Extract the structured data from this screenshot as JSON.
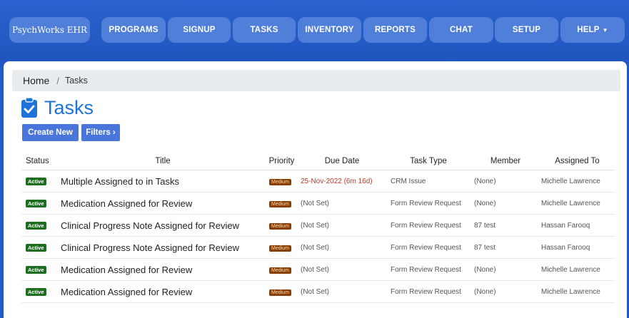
{
  "brand": {
    "label": "PsychWorks EHR"
  },
  "nav": [
    {
      "label": "PROGRAMS"
    },
    {
      "label": "SIGNUP"
    },
    {
      "label": "TASKS"
    },
    {
      "label": "INVENTORY"
    },
    {
      "label": "REPORTS"
    },
    {
      "label": "CHAT"
    },
    {
      "label": "SETUP"
    },
    {
      "label": "HELP"
    }
  ],
  "breadcrumb": {
    "home": "Home",
    "separator": "/",
    "current": "Tasks"
  },
  "page": {
    "title": "Tasks",
    "icon": "clipboard-check-icon"
  },
  "actions": {
    "create_new": "Create New",
    "filters": "Filters ›"
  },
  "table": {
    "columns": [
      "Status",
      "Title",
      "Priority",
      "Due Date",
      "Task Type",
      "Member",
      "Assigned To"
    ],
    "rows": [
      {
        "status": "Active",
        "title": "Multiple Assigned to in Tasks",
        "priority": "Medium",
        "due": "25-Nov-2022 (6m 16d)",
        "type": "CRM Issue",
        "member": "(None)",
        "assigned": "Michelle Lawrence"
      },
      {
        "status": "Active",
        "title": "Medication Assigned for Review",
        "priority": "Medium",
        "due": "(Not Set)",
        "type": "Form Review Request",
        "member": "(None)",
        "assigned": "Michelle Lawrence"
      },
      {
        "status": "Active",
        "title": "Clinical Progress Note Assigned for Review",
        "priority": "Medium",
        "due": "(Not Set)",
        "type": "Form Review Request",
        "member": "87 test",
        "assigned": "Hassan Farooq"
      },
      {
        "status": "Active",
        "title": "Clinical Progress Note Assigned for Review",
        "priority": "Medium",
        "due": "(Not Set)",
        "type": "Form Review Request",
        "member": "87 test",
        "assigned": "Hassan Farooq"
      },
      {
        "status": "Active",
        "title": "Medication Assigned for Review",
        "priority": "Medium",
        "due": "(Not Set)",
        "type": "Form Review Request",
        "member": "(None)",
        "assigned": "Michelle Lawrence"
      },
      {
        "status": "Active",
        "title": "Medication Assigned for Review",
        "priority": "Medium",
        "due": "(Not Set)",
        "type": "Form Review Request",
        "member": "(None)",
        "assigned": "Michelle Lawrence"
      }
    ]
  },
  "colors": {
    "header_bg": "#2158c4",
    "nav_button": "#4f7fd9",
    "title_blue": "#1e73d8",
    "action_button": "#4a76db",
    "active_badge": "#1f6e20",
    "medium_badge": "#8a3f00",
    "overdue_text": "#c0392b"
  }
}
